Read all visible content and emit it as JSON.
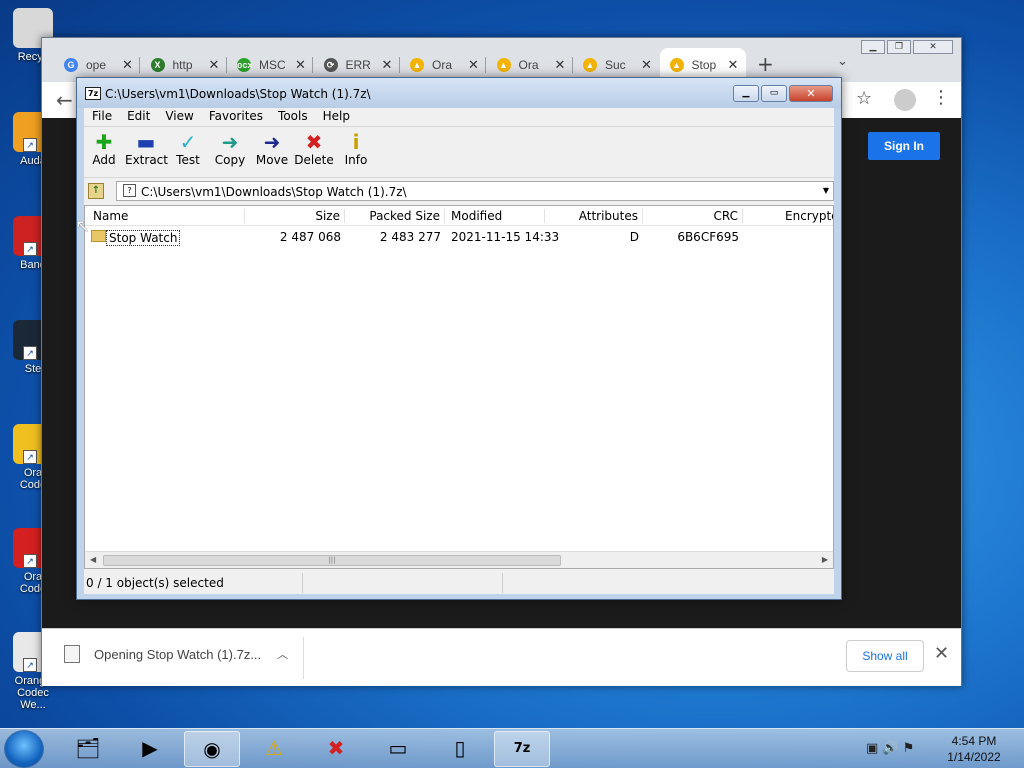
{
  "desktop": {
    "icons": [
      {
        "label": "Recyc",
        "name": "recycle-bin-icon"
      },
      {
        "label": "Auda",
        "name": "audacity-icon"
      },
      {
        "label": "Band",
        "name": "bandicam-icon"
      },
      {
        "label": "Ste",
        "name": "steam-icon"
      },
      {
        "label": "Ora\nCode",
        "name": "orange-codec-warning-icon"
      },
      {
        "label": "Ora\nCode",
        "name": "orange-codec-error-icon"
      },
      {
        "label": "Orange\nCodec We...",
        "name": "orange-codec-web-icon"
      }
    ]
  },
  "browser": {
    "tabs": [
      {
        "title": "ope",
        "fav": "G",
        "fav_color": "#4285f4"
      },
      {
        "title": "http",
        "fav": "X",
        "fav_color": "#2d7d2d"
      },
      {
        "title": "MSC",
        "fav": "ocx",
        "fav_color": "#2aa12a"
      },
      {
        "title": "ERR",
        "fav": "⟳",
        "fav_color": "#555555"
      },
      {
        "title": "Ora",
        "fav": "▲",
        "fav_color": "#f4b400"
      },
      {
        "title": "Ora",
        "fav": "▲",
        "fav_color": "#f4b400"
      },
      {
        "title": "Suc",
        "fav": "▲",
        "fav_color": "#f4b400"
      },
      {
        "title": "Stop",
        "fav": "▲",
        "fav_color": "#f4b400"
      }
    ],
    "sign_in": "Sign In",
    "download": {
      "file_text": "Opening Stop Watch (1).7z...",
      "show_all": "Show all"
    }
  },
  "sevenzip": {
    "title": "C:\\Users\\vm1\\Downloads\\Stop Watch (1).7z\\",
    "menu": [
      "File",
      "Edit",
      "View",
      "Favorites",
      "Tools",
      "Help"
    ],
    "toolbar": [
      {
        "label": "Add",
        "icon": "add-icon",
        "glyph": "✚",
        "color": "#1aa51a"
      },
      {
        "label": "Extract",
        "icon": "extract-icon",
        "glyph": "▬",
        "color": "#1f3fb0"
      },
      {
        "label": "Test",
        "icon": "test-icon",
        "glyph": "✓",
        "color": "#2ab0c8"
      },
      {
        "label": "Copy",
        "icon": "copy-icon",
        "glyph": "➜",
        "color": "#1f9a8a"
      },
      {
        "label": "Move",
        "icon": "move-icon",
        "glyph": "➜",
        "color": "#1a2a90"
      },
      {
        "label": "Delete",
        "icon": "delete-icon",
        "glyph": "✖",
        "color": "#d42020"
      },
      {
        "label": "Info",
        "icon": "info-icon",
        "glyph": "i",
        "color": "#c8a000"
      }
    ],
    "address": "C:\\Users\\vm1\\Downloads\\Stop Watch (1).7z\\",
    "columns": [
      "Name",
      "Size",
      "Packed Size",
      "Modified",
      "Attributes",
      "CRC",
      "Encrypte"
    ],
    "rows": [
      {
        "name": "Stop Watch",
        "size": "2 487 068",
        "packed": "2 483 277",
        "modified": "2021-11-15 14:33",
        "attributes": "D",
        "crc": "6B6CF695",
        "encrypted": ""
      }
    ],
    "status": "0 / 1 object(s) selected"
  },
  "taskbar": {
    "time": "4:54 PM",
    "date": "1/14/2022"
  }
}
